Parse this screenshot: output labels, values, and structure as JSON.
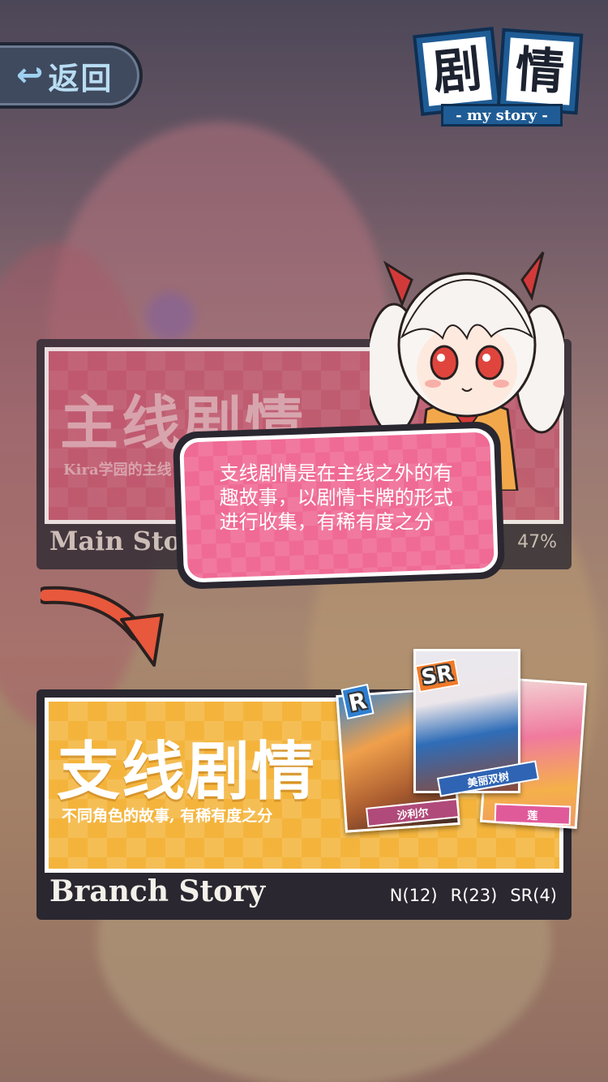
{
  "nav": {
    "back_label": "返回",
    "back_arrow": "↩"
  },
  "title": {
    "char1": "剧",
    "char2": "情",
    "subtitle": "- my story -"
  },
  "main_story": {
    "title": "主线剧情",
    "description": "Kira学园的主线",
    "english": "Main Story",
    "progress": "47%"
  },
  "branch_story": {
    "title": "支线剧情",
    "description": "不同角色的故事, 有稀有度之分",
    "english": "Branch Story",
    "counts": [
      "N(12)",
      "R(23)",
      "SR(4)"
    ],
    "cards": [
      {
        "rarity": "R",
        "name": "沙利尔"
      },
      {
        "rarity": "SR",
        "name": "美丽双树"
      },
      {
        "rarity": "",
        "name": "莲"
      }
    ]
  },
  "tutorial": {
    "text": "支线剧情是在主线之外的有趣故事，以剧情卡牌的形式进行收集，有稀有度之分"
  },
  "colors": {
    "main_card": "#c8566f",
    "branch_card": "#f4b43c",
    "bubble": "#ef6a94",
    "arrow": "#e8583c",
    "title_tile": "#1f5c95"
  }
}
